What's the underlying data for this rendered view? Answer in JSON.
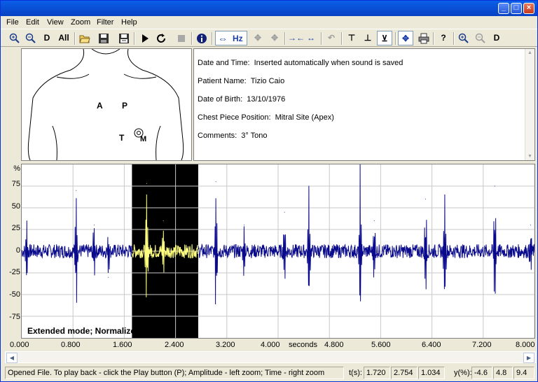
{
  "window": {
    "controls": [
      "minimize",
      "maximize",
      "close"
    ]
  },
  "menubar": {
    "items": [
      "File",
      "Edit",
      "View",
      "Zoom",
      "Filter",
      "Help"
    ]
  },
  "toolbar": {
    "d_label": "D",
    "all_label": "All",
    "hz_label": "Hz",
    "d2_label": "D"
  },
  "body_map": {
    "site_a": "A",
    "site_p": "P",
    "site_t": "T",
    "site_m": "M"
  },
  "patient": {
    "date_label": "Date and Time:",
    "date_value": "Inserted automatically when sound is saved",
    "name_label": "Patient Name:",
    "name_value": "Tizio Caio",
    "dob_label": "Date of Birth:",
    "dob_value": "13/10/1976",
    "chest_label": "Chest Piece Position:",
    "chest_value": "Mitral Site (Apex)",
    "comments_label": "Comments:",
    "comments_value": "3° Tono"
  },
  "chart_data": {
    "type": "line",
    "title": "",
    "ylabel": "%",
    "xlabel": "seconds",
    "y_ticks": [
      "75",
      "50",
      "25",
      "0",
      "-25",
      "-50",
      "-75"
    ],
    "x_ticks": [
      "0.000",
      "0.800",
      "1.600",
      "2.400",
      "3.200",
      "4.000",
      "4.800",
      "5.600",
      "6.400",
      "7.200",
      "8.000"
    ],
    "ylim": [
      -100,
      100
    ],
    "xlim": [
      0,
      8
    ],
    "grid": true,
    "mode_text": "Extended mode; Normalized",
    "selection": {
      "start": 1.72,
      "end": 2.754
    },
    "colors": {
      "wave": "#0A0A8C",
      "selected_wave": "#FFFF80",
      "selection_bg": "#000000",
      "grid": "#C8C8C8"
    },
    "series": [
      {
        "values": [
          {
            "x": 0.08,
            "y": 35
          },
          {
            "x": 0.85,
            "y": 70
          },
          {
            "x": 1.13,
            "y": 30
          },
          {
            "x": 1.35,
            "y": -30
          },
          {
            "x": 1.95,
            "y": 78
          },
          {
            "x": 2.21,
            "y": 35
          },
          {
            "x": 3.03,
            "y": 80
          },
          {
            "x": 3.47,
            "y": 30
          },
          {
            "x": 4.1,
            "y": 45
          },
          {
            "x": 4.48,
            "y": 70
          },
          {
            "x": 5.28,
            "y": 96
          },
          {
            "x": 5.5,
            "y": 35
          },
          {
            "x": 6.3,
            "y": 60
          },
          {
            "x": 6.6,
            "y": 60
          },
          {
            "x": 7.38,
            "y": 75
          },
          {
            "x": 7.94,
            "y": 30
          }
        ]
      }
    ]
  },
  "status": {
    "message": "Opened File. To play back - click the Play button (P); Amplitude - left zoom; Time - right zoom",
    "t_label": "t(s):",
    "t1": "1.720",
    "t2": "2.754",
    "t3": "1.034",
    "y_label": "y(%):",
    "y1": "-4.6",
    "y2": "4.8",
    "y3": "9.4"
  }
}
